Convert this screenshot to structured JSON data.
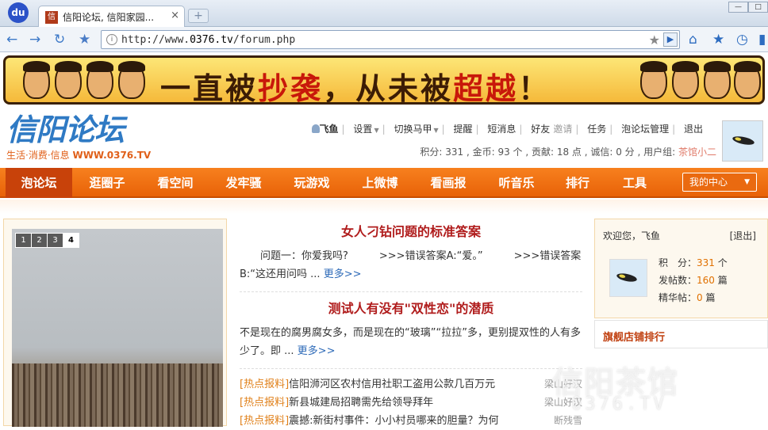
{
  "browser": {
    "logo": "du",
    "tab_title": "信阳论坛, 信阳家园...",
    "tab_favicon": "信",
    "url_prefix": "http://www.",
    "url_domain": "0376.tv",
    "url_path": "/forum.php"
  },
  "banner": {
    "text_a": "一直被",
    "text_hl1": "抄袭",
    "text_b": "，",
    "text_c": "从未被",
    "text_hl2": "超越",
    "text_d": "！"
  },
  "site": {
    "logo": "信阳论坛",
    "slogan_a": "生活·消费·信息 ",
    "slogan_url": "WWW.0376.TV"
  },
  "userbar": {
    "username": "飞鱼",
    "items": [
      "设置",
      "切换马甲",
      "提醒",
      "短消息",
      "好友",
      "邀请",
      "任务",
      "泡论坛管理",
      "退出"
    ]
  },
  "credits": {
    "text": "积分: 331 , 金币: 93 个 , 贡献: 18 点 , 诚信: 0 分 , 用户组: ",
    "group": "茶馆小二"
  },
  "mainnav": {
    "items": [
      "泡论坛",
      "逛圈子",
      "看空间",
      "发牢骚",
      "玩游戏",
      "上微博",
      "看画报",
      "听音乐",
      "排行",
      "工具"
    ],
    "mycenter": "我的中心"
  },
  "slider": {
    "pages": [
      "1",
      "2",
      "3",
      "4"
    ],
    "active": 4
  },
  "articles": [
    {
      "title": "女人刁钻问题的标准答案",
      "body": "问题一：你爱我吗?　　　>>>错误答案A:“爱。”　　　>>>错误答案B:“这还用问吗 ... ",
      "more": "更多>>"
    },
    {
      "title": "测试人有没有\"双性恋\"的潜质",
      "body": "不是现在的腐男腐女多，而是现在的“玻璃”“拉拉”多，更别提双性的人有多少了。即 ... ",
      "more": "更多>>"
    }
  ],
  "news": [
    {
      "tag": "[热点报料]",
      "title": "信阳浉河区农村信用社职工盗用公款几百万元",
      "author": "梁山好汉"
    },
    {
      "tag": "[热点报料]",
      "title": "新县城建局招聘需先给领导拜年",
      "author": "梁山好汉"
    },
    {
      "tag": "[热点报料]",
      "title": "震撼:新街村事件：小小村员哪来的胆量？为何",
      "author": "断残雪"
    }
  ],
  "profile": {
    "welcome": "欢迎您，飞鱼",
    "logout": "[退出]",
    "credits_label": "积　分：",
    "credits": "331",
    "credits_unit": " 个",
    "posts_label": "发帖数：",
    "posts": "160",
    "posts_unit": " 篇",
    "digest_label": "精华帖：",
    "digest": "0",
    "digest_unit": " 篇"
  },
  "shop": {
    "title": "旗舰店铺排行"
  },
  "watermark": {
    "line1": "信阳茶馆",
    "line2": "0376.TV"
  }
}
